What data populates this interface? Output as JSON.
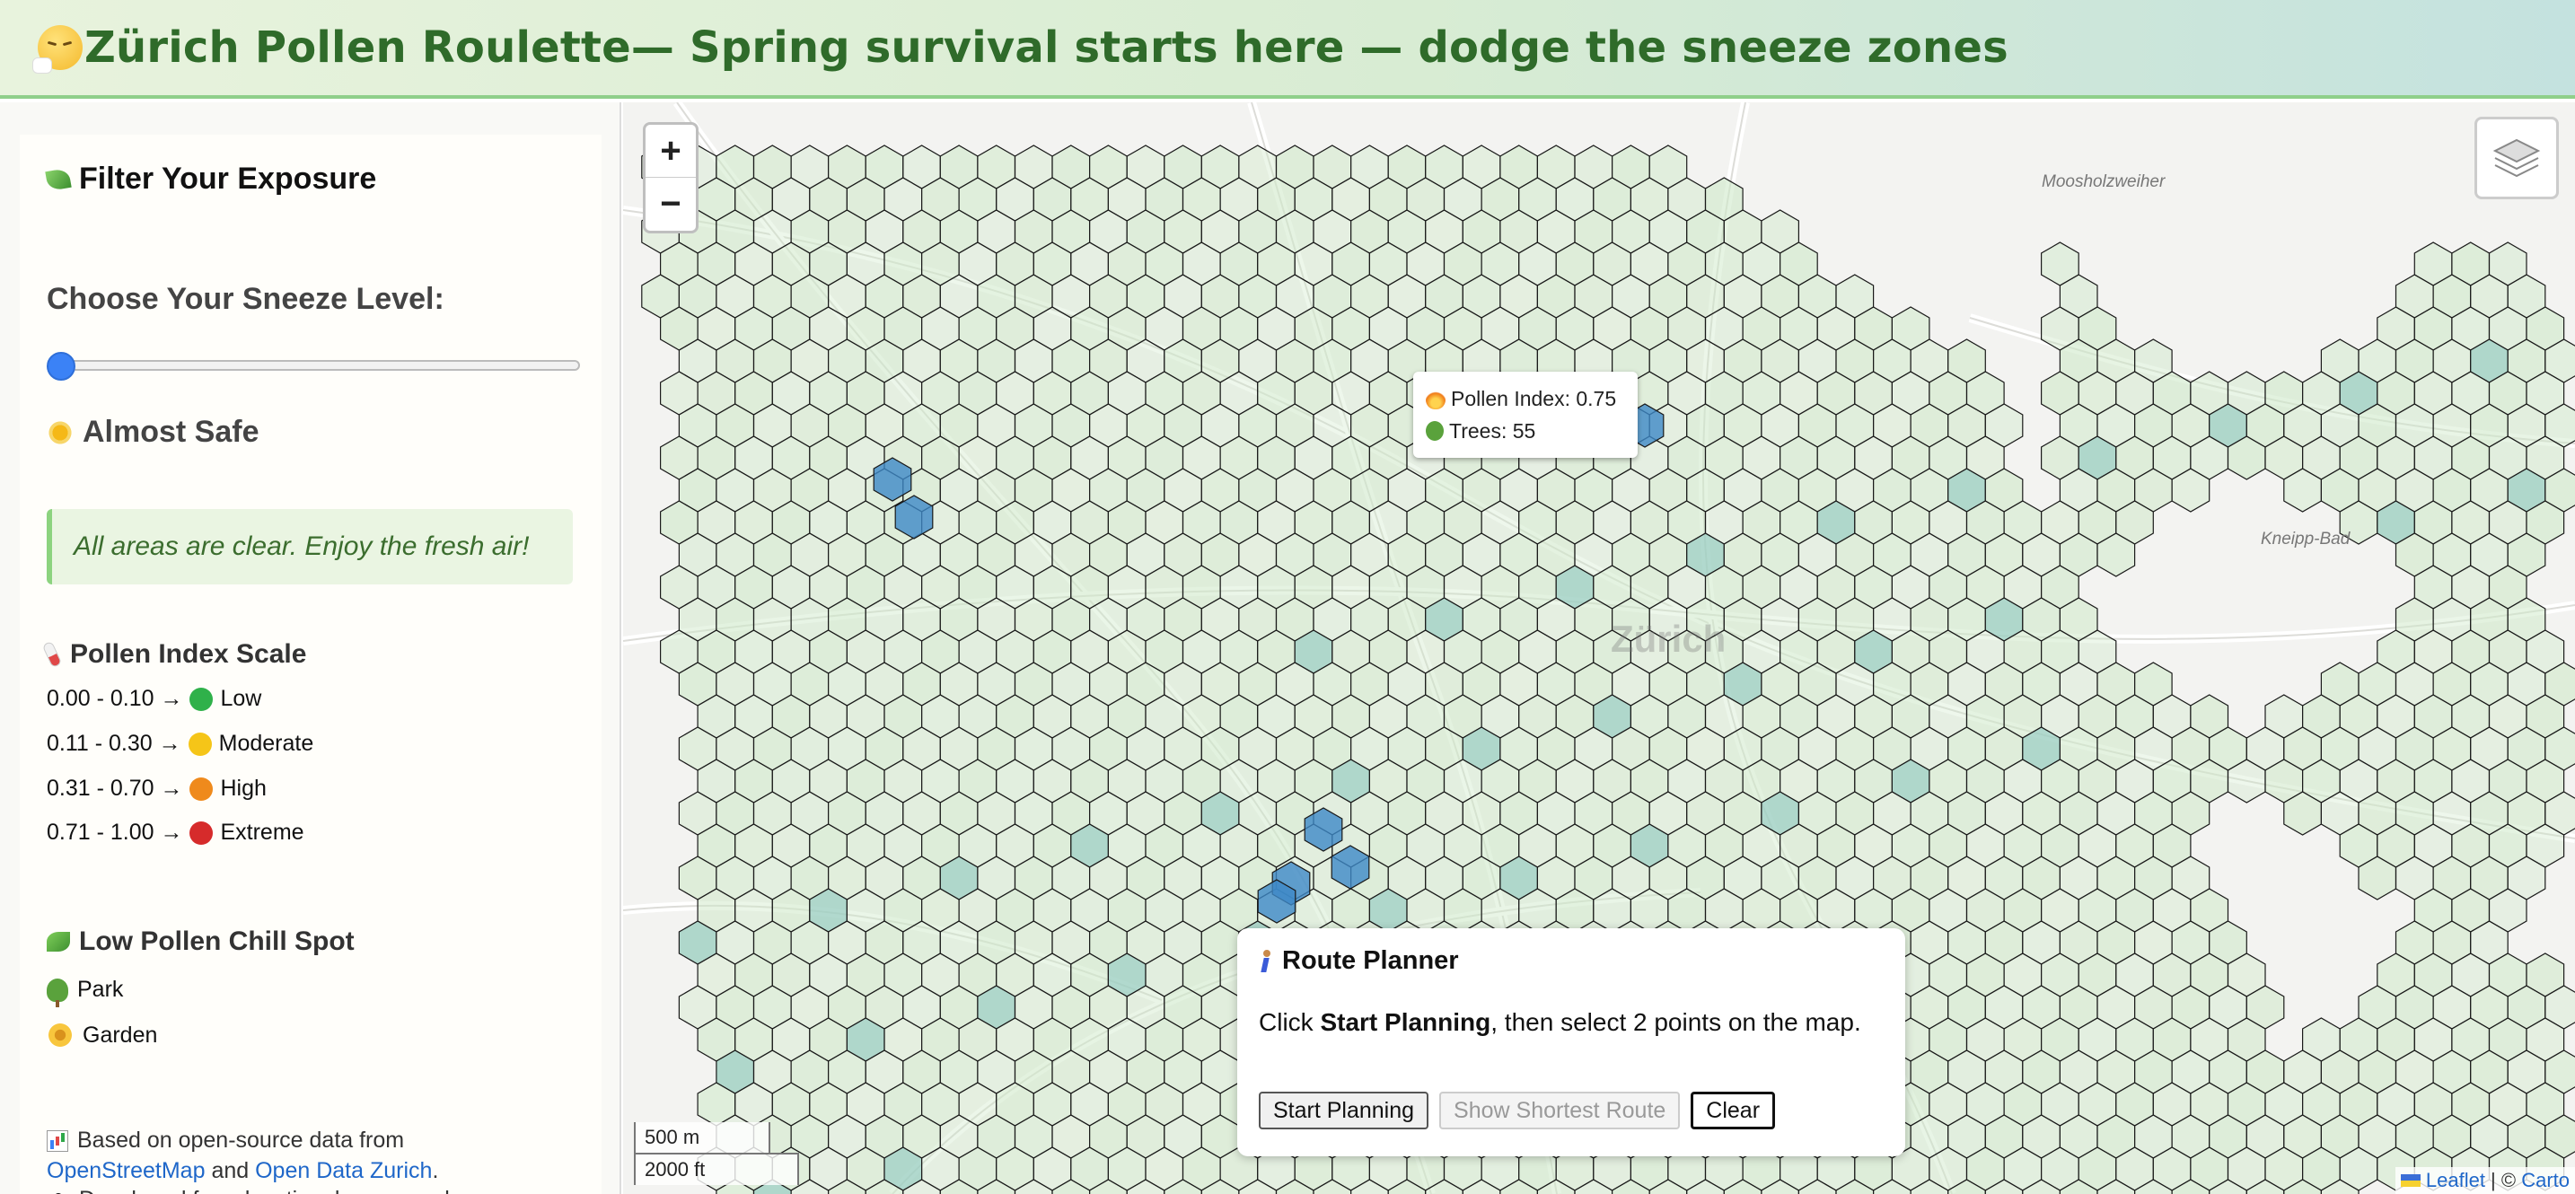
{
  "header": {
    "title": "Zürich Pollen Roulette— Spring survival starts here — dodge the sneeze zones"
  },
  "sidebar": {
    "filter_title": "Filter Your Exposure",
    "sneeze_label": "Choose Your Sneeze Level:",
    "slider_value": 0,
    "level_title": "Almost Safe",
    "status_text": "All areas are clear. Enjoy the fresh air!",
    "scale_title": "Pollen Index Scale",
    "scale": [
      {
        "range": "0.00 - 0.10 →",
        "label": "Low",
        "color": "#2fb14a"
      },
      {
        "range": "0.11 - 0.30 →",
        "label": "Moderate",
        "color": "#f5c518"
      },
      {
        "range": "0.31 - 0.70 →",
        "label": "High",
        "color": "#ef8a1c"
      },
      {
        "range": "0.71 - 1.00 →",
        "label": "Extreme",
        "color": "#d62b2b"
      }
    ],
    "chill_title": "Low Pollen Chill Spot",
    "chill_items": [
      {
        "icon": "tree-icon",
        "label": "Park"
      },
      {
        "icon": "flower-icon",
        "label": "Garden"
      }
    ],
    "credit_prefix": "Based on open-source data from",
    "credit_link1": "OpenStreetMap",
    "credit_and": " and ",
    "credit_link2": "Open Data Zurich",
    "credit_period": ".",
    "credit_dev": "Developed for educational purposes by"
  },
  "map": {
    "zoom_in": "+",
    "zoom_out": "−",
    "tooltip": {
      "pollen_label": "Pollen Index: 0.75",
      "trees_label": "Trees: 55"
    },
    "labels": [
      "Moosholzweiher",
      "Kneipp-Bad",
      "Zürich"
    ],
    "scale_m": "500 m",
    "scale_ft": "2000 ft",
    "attribution_leaflet": "Leaflet",
    "attribution_sep": " | © ",
    "attribution_carto": "Carto",
    "colors": {
      "hex_fill": "#cfe9c9",
      "hex_highlight": "#3d88c7",
      "hex_mid": "#9ed0c2"
    }
  },
  "route_planner": {
    "title": "Route Planner",
    "desc_prefix": "Click ",
    "desc_bold": "Start Planning",
    "desc_suffix": ", then select 2 points on the map.",
    "start_button": "Start Planning",
    "shortest_button": "Show Shortest Route",
    "clear_button": "Clear"
  }
}
